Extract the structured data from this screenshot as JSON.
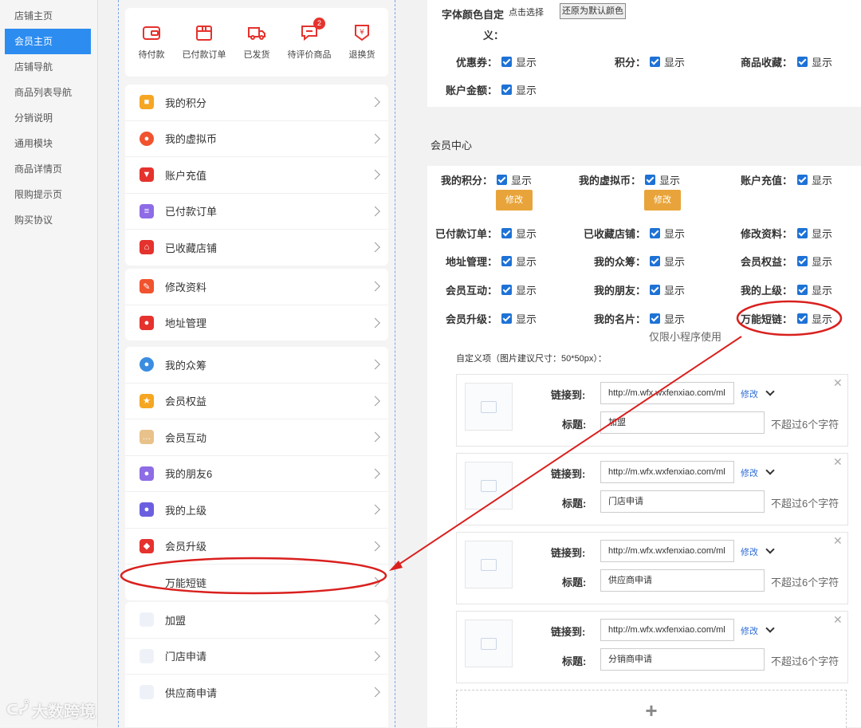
{
  "sidebar": {
    "items": [
      {
        "label": "店铺主页",
        "active": false
      },
      {
        "label": "会员主页",
        "active": true
      },
      {
        "label": "店铺导航",
        "active": false
      },
      {
        "label": "商品列表导航",
        "active": false
      },
      {
        "label": "分销说明",
        "active": false
      },
      {
        "label": "通用模块",
        "active": false
      },
      {
        "label": "商品详情页",
        "active": false
      },
      {
        "label": "限购提示页",
        "active": false
      },
      {
        "label": "购买协议",
        "active": false
      }
    ]
  },
  "preview": {
    "orders": [
      {
        "label": "待付款",
        "icon": "wallet-icon"
      },
      {
        "label": "已付款订单",
        "icon": "box-icon"
      },
      {
        "label": "已发货",
        "icon": "truck-icon"
      },
      {
        "label": "待评价商品",
        "icon": "comment-icon",
        "badge": "2"
      },
      {
        "label": "退换货",
        "icon": "refund-icon"
      }
    ],
    "group1": [
      "我的积分",
      "我的虚拟币",
      "账户充值",
      "已付款订单",
      "已收藏店铺"
    ],
    "group2": [
      "修改资料",
      "地址管理"
    ],
    "group3": [
      "我的众筹",
      "会员权益",
      "会员互动",
      "我的朋友6",
      "我的上级",
      "会员升级",
      "万能短链"
    ],
    "group4": [
      "加盟",
      "门店申请",
      "供应商申请"
    ]
  },
  "settings": {
    "font_color_label": "字体颜色自定义：",
    "pick_link": "点击选择",
    "reset_button": "还原为默认颜色",
    "top_checks": [
      {
        "label": "优惠券：",
        "value": "显示"
      },
      {
        "label": "积分：",
        "value": "显示"
      },
      {
        "label": "商品收藏：",
        "value": "显示"
      },
      {
        "label": "账户金额：",
        "value": "显示"
      }
    ],
    "member_center_title": "会员中心",
    "member_checks": [
      {
        "label": "我的积分：",
        "value": "显示"
      },
      {
        "label": "我的虚拟币：",
        "value": "显示"
      },
      {
        "label": "账户充值：",
        "value": "显示"
      },
      {
        "label": "已付款订单：",
        "value": "显示"
      },
      {
        "label": "已收藏店铺：",
        "value": "显示"
      },
      {
        "label": "修改资料：",
        "value": "显示"
      },
      {
        "label": "地址管理：",
        "value": "显示"
      },
      {
        "label": "我的众筹：",
        "value": "显示"
      },
      {
        "label": "会员权益：",
        "value": "显示"
      },
      {
        "label": "会员互动：",
        "value": "显示"
      },
      {
        "label": "我的朋友：",
        "value": "显示"
      },
      {
        "label": "我的上级：",
        "value": "显示"
      },
      {
        "label": "会员升级：",
        "value": "显示"
      },
      {
        "label": "我的名片：",
        "value": "显示"
      },
      {
        "label": "万能短链：",
        "value": "显示"
      }
    ],
    "edit_button": "修改",
    "mini_program_note": "仅限小程序使用",
    "custom_title": "自定义项（图片建议尺寸：50*50px）：",
    "link_label": "链接到:",
    "title_label": "标题:",
    "edit_link": "修改",
    "limit_hint": "不超过6个字符",
    "custom_items": [
      {
        "url": "http://m.wfx.wxfenxiao.com/ml",
        "title": "加盟"
      },
      {
        "url": "http://m.wfx.wxfenxiao.com/ml",
        "title": "门店申请"
      },
      {
        "url": "http://m.wfx.wxfenxiao.com/ml",
        "title": "供应商申请"
      },
      {
        "url": "http://m.wfx.wxfenxiao.com/ml",
        "title": "分销商申请"
      }
    ],
    "add_symbol": "+"
  },
  "watermark": "大数跨境"
}
